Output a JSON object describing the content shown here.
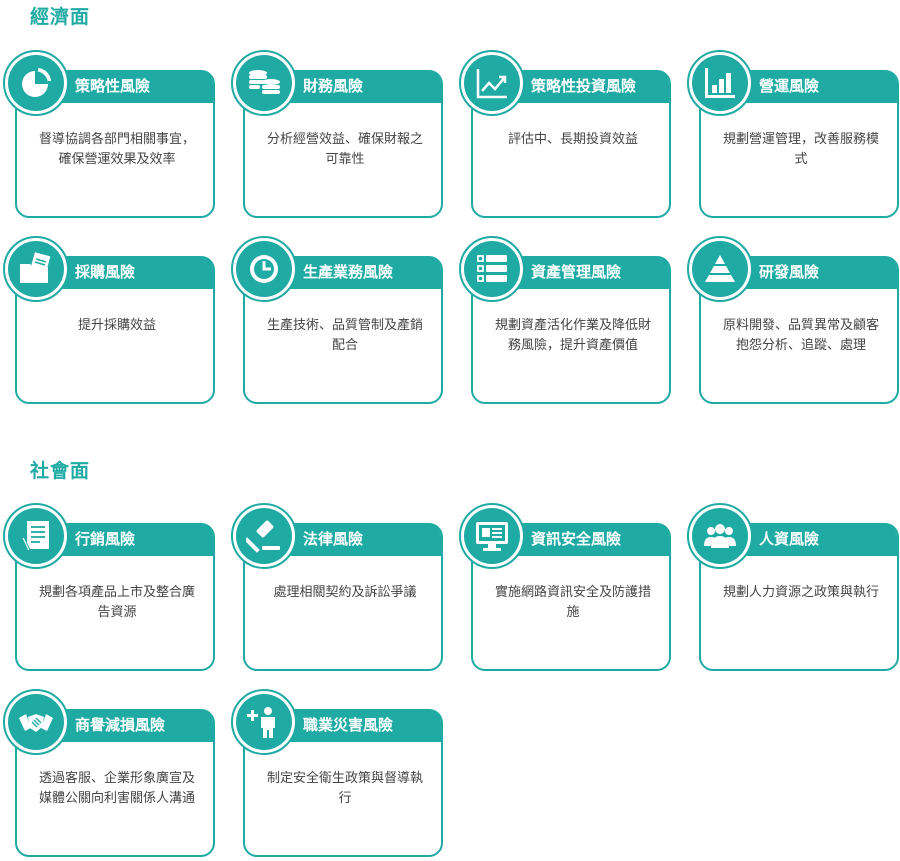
{
  "sections": [
    {
      "title": "經濟面",
      "cards": [
        {
          "title": "策略性風險",
          "desc": "督導協調各部門相關事宜，確保營運效果及效率",
          "icon": "pie-chart-icon"
        },
        {
          "title": "財務風險",
          "desc": "分析經營效益、確保財報之可靠性",
          "icon": "coin-stack-icon"
        },
        {
          "title": "策略性投資風險",
          "desc": "評估中、長期投資效益",
          "icon": "trend-chart-icon"
        },
        {
          "title": "營運風險",
          "desc": "規劃營運管理，改善服務模式",
          "icon": "bar-chart-icon"
        },
        {
          "title": "採購風險",
          "desc": "提升採購效益",
          "icon": "folder-documents-icon"
        },
        {
          "title": "生產業務風險",
          "desc": "生產技術、品質管制及產銷配合",
          "icon": "clock-icon"
        },
        {
          "title": "資產管理風險",
          "desc": "規劃資產活化作業及降低財務風險，提升資產價值",
          "icon": "list-icon"
        },
        {
          "title": "研發風險",
          "desc": "原料開發、品質異常及顧客抱怨分析、追蹤、處理",
          "icon": "pyramid-icon"
        }
      ]
    },
    {
      "title": "社會面",
      "cards": [
        {
          "title": "行銷風險",
          "desc": "規劃各項產品上市及整合廣告資源",
          "icon": "document-pen-icon"
        },
        {
          "title": "法律風險",
          "desc": "處理相關契約及訴訟爭議",
          "icon": "gavel-icon"
        },
        {
          "title": "資訊安全風險",
          "desc": "實施網路資訊安全及防護措施",
          "icon": "monitor-icon"
        },
        {
          "title": "人資風險",
          "desc": "規劃人力資源之政策與執行",
          "icon": "people-icon"
        },
        {
          "title": "商譽減損風險",
          "desc": "透過客服、企業形象廣宣及媒體公關向利害關係人溝通",
          "icon": "handshake-icon"
        },
        {
          "title": "職業災害風險",
          "desc": "制定安全衛生政策與督導執行",
          "icon": "person-plus-icon"
        }
      ]
    }
  ]
}
